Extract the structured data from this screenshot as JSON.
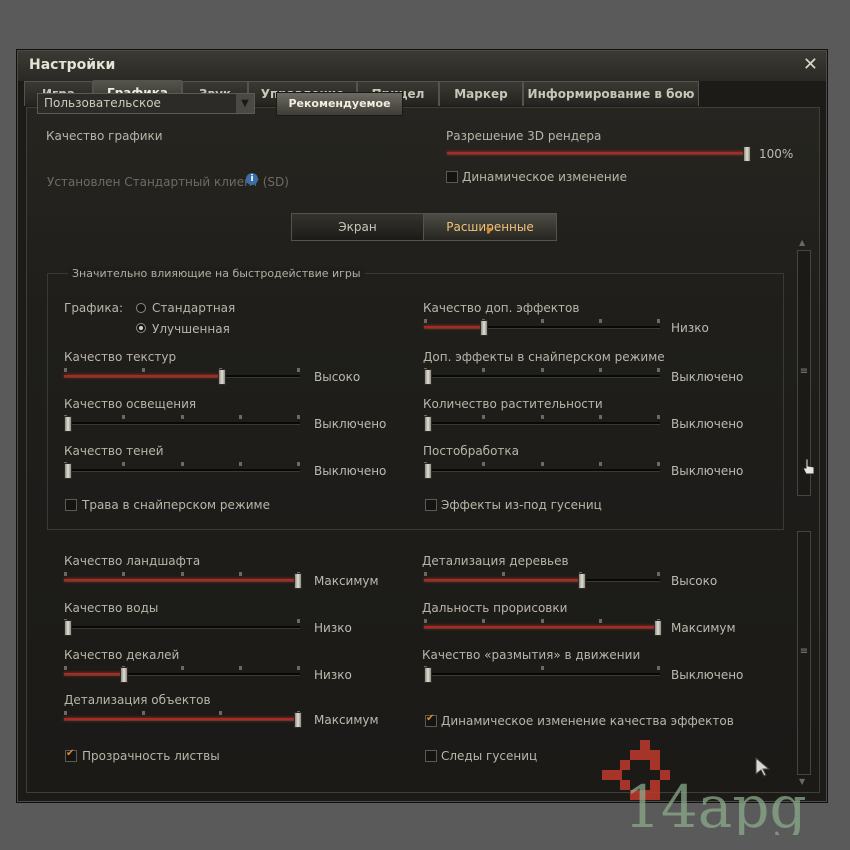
{
  "window": {
    "title": "Настройки"
  },
  "tabs": [
    "Игра",
    "Графика",
    "Звук",
    "Управление",
    "Прицел",
    "Маркер",
    "Информирование в бою"
  ],
  "active_tab": 1,
  "quality": {
    "label": "Качество графики",
    "selected": "Пользовательское",
    "recommended_button": "Рекомендуемое",
    "client_note": "Установлен Стандартный клиент (SD)"
  },
  "render": {
    "label": "Разрешение 3D рендера",
    "value_text": "100%",
    "value": 100,
    "dynamic_label": "Динамическое изменение",
    "dynamic_checked": false
  },
  "subtabs": [
    "Экран",
    "Расширенные"
  ],
  "active_subtab": 1,
  "group": {
    "title": "Значительно влияющие на быстродействие игры"
  },
  "graphics_mode": {
    "label": "Графика:",
    "options": [
      "Стандартная",
      "Улучшенная"
    ],
    "selected": 1
  },
  "sliders": {
    "texture": {
      "label": "Качество текстур",
      "value_text": "Высоко",
      "level": 0.667
    },
    "lighting": {
      "label": "Качество освещения",
      "value_text": "Выключено",
      "level": 0
    },
    "shadows": {
      "label": "Качество теней",
      "value_text": "Выключено",
      "level": 0
    },
    "extra_fx": {
      "label": "Качество доп. эффектов",
      "value_text": "Низко",
      "level": 0.25
    },
    "sniper_fx": {
      "label": "Доп. эффекты в снайперском режиме",
      "value_text": "Выключено",
      "level": 0
    },
    "vegetation": {
      "label": "Количество растительности",
      "value_text": "Выключено",
      "level": 0
    },
    "postproc": {
      "label": "Постобработка",
      "value_text": "Выключено",
      "level": 0
    },
    "landscape": {
      "label": "Качество ландшафта",
      "value_text": "Максимум",
      "level": 1
    },
    "water": {
      "label": "Качество воды",
      "value_text": "Низко",
      "level": 0
    },
    "decals": {
      "label": "Качество декалей",
      "value_text": "Низко",
      "level": 0.25
    },
    "objects": {
      "label": "Детализация объектов",
      "value_text": "Максимум",
      "level": 1
    },
    "trees": {
      "label": "Детализация деревьев",
      "value_text": "Высоко",
      "level": 0.667
    },
    "draw_dist": {
      "label": "Дальность прорисовки",
      "value_text": "Максимум",
      "level": 1
    },
    "motion_blur": {
      "label": "Качество «размытия» в движении",
      "value_text": "Выключено",
      "level": 0
    }
  },
  "checkboxes": {
    "sniper_grass": {
      "label": "Трава в снайперском режиме",
      "checked": false
    },
    "track_effects": {
      "label": "Эффекты из-под гусениц",
      "checked": false
    },
    "dynamic_fx": {
      "label": "Динамическое изменение качества эффектов",
      "checked": true
    },
    "foliage": {
      "label": "Прозрачность листвы",
      "checked": true
    },
    "track_marks": {
      "label": "Следы гусениц",
      "checked": false
    }
  },
  "watermark": {
    "text": "14apg"
  },
  "colors": {
    "accent": "#e08a2e",
    "slider_fill": "#a72b22",
    "background": "#1c1b18"
  }
}
